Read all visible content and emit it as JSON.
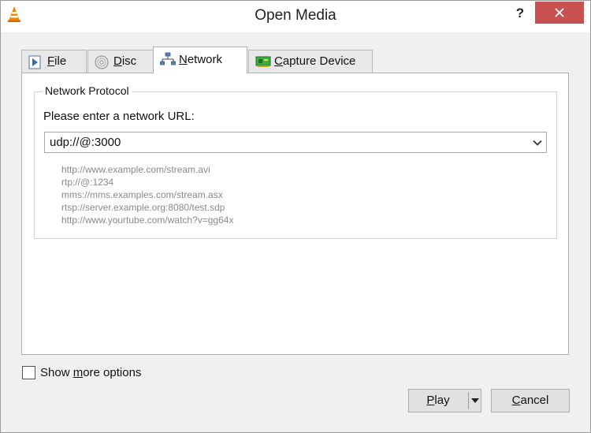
{
  "window": {
    "title": "Open Media",
    "help_label": "?"
  },
  "tabs": [
    {
      "label_pre": "",
      "accel": "F",
      "label_post": "ile",
      "icon": "file-play-icon"
    },
    {
      "label_pre": "",
      "accel": "D",
      "label_post": "isc",
      "icon": "disc-icon"
    },
    {
      "label_pre": "",
      "accel": "N",
      "label_post": "etwork",
      "icon": "network-icon",
      "active": true
    },
    {
      "label_pre": "",
      "accel": "C",
      "label_post": "apture Device",
      "icon": "capture-card-icon"
    }
  ],
  "network": {
    "group_title": "Network Protocol",
    "url_label": "Please enter a network URL:",
    "url_value": "udp://@:3000",
    "examples": [
      "http://www.example.com/stream.avi",
      "rtp://@:1234",
      "mms://mms.examples.com/stream.asx",
      "rtsp://server.example.org:8080/test.sdp",
      "http://www.yourtube.com/watch?v=gg64x"
    ]
  },
  "options": {
    "more_pre": "Show ",
    "more_accel": "m",
    "more_post": "ore options",
    "checked": false
  },
  "buttons": {
    "play_accel": "P",
    "play_post": "lay",
    "cancel_accel": "C",
    "cancel_post": "ancel"
  },
  "colors": {
    "close_button": "#c75050",
    "window_bg": "#f0f0f0",
    "panel_bg": "#ffffff",
    "example_text": "#8a8a8a"
  }
}
